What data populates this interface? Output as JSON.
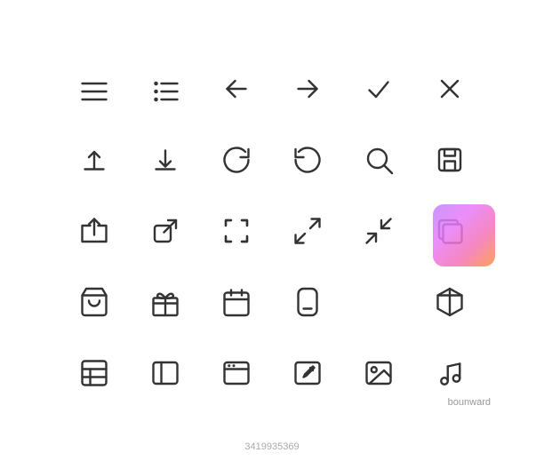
{
  "watermark": "bounward",
  "stock_id": "3419935369",
  "icons": [
    {
      "name": "hamburger-menu",
      "row": 1,
      "col": 1
    },
    {
      "name": "list-menu",
      "row": 1,
      "col": 2
    },
    {
      "name": "arrow-left",
      "row": 1,
      "col": 3
    },
    {
      "name": "arrow-right",
      "row": 1,
      "col": 4
    },
    {
      "name": "checkmark",
      "row": 1,
      "col": 5
    },
    {
      "name": "close-x",
      "row": 1,
      "col": 6
    },
    {
      "name": "upload",
      "row": 2,
      "col": 1
    },
    {
      "name": "download",
      "row": 2,
      "col": 2
    },
    {
      "name": "refresh-cw",
      "row": 2,
      "col": 3
    },
    {
      "name": "refresh-ccw",
      "row": 2,
      "col": 4
    },
    {
      "name": "search",
      "row": 2,
      "col": 5
    },
    {
      "name": "save-floppy",
      "row": 2,
      "col": 6
    },
    {
      "name": "share-forward",
      "row": 3,
      "col": 1
    },
    {
      "name": "external-link",
      "row": 3,
      "col": 2
    },
    {
      "name": "expand-small",
      "row": 3,
      "col": 3
    },
    {
      "name": "expand-large",
      "row": 3,
      "col": 4
    },
    {
      "name": "compress",
      "row": 3,
      "col": 5
    },
    {
      "name": "layers",
      "row": 3,
      "col": 6
    },
    {
      "name": "shopping-bag",
      "row": 4,
      "col": 1
    },
    {
      "name": "gift",
      "row": 4,
      "col": 2
    },
    {
      "name": "calendar",
      "row": 4,
      "col": 3
    },
    {
      "name": "phone-rounded",
      "row": 4,
      "col": 4
    },
    {
      "name": "cube-3d",
      "row": 4,
      "col": 6
    },
    {
      "name": "table-grid",
      "row": 5,
      "col": 1
    },
    {
      "name": "sidebar-panel",
      "row": 5,
      "col": 2
    },
    {
      "name": "browser-window",
      "row": 5,
      "col": 3
    },
    {
      "name": "edit-pencil",
      "row": 5,
      "col": 4
    },
    {
      "name": "image-photo",
      "row": 5,
      "col": 5
    },
    {
      "name": "music-notes",
      "row": 5,
      "col": 6
    }
  ]
}
